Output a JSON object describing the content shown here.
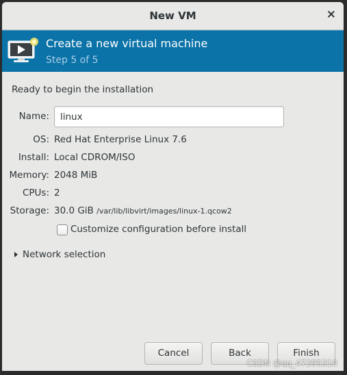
{
  "window": {
    "title": "New VM",
    "close_glyph": "×"
  },
  "banner": {
    "title": "Create a new virtual machine",
    "step": "Step 5 of 5",
    "icon": "virtual-machine-new-icon",
    "background_color": "#0b73a8"
  },
  "summary": {
    "heading": "Ready to begin the installation",
    "name": {
      "label": "Name:",
      "value": "linux"
    },
    "os": {
      "label": "OS:",
      "value": "Red Hat Enterprise Linux 7.6"
    },
    "install": {
      "label": "Install:",
      "value": "Local CDROM/ISO"
    },
    "memory": {
      "label": "Memory:",
      "value": "2048 MiB"
    },
    "cpus": {
      "label": "CPUs:",
      "value": "2"
    },
    "storage": {
      "label": "Storage:",
      "value": "30.0 GiB",
      "path": "/var/lib/libvirt/images/linux-1.qcow2"
    }
  },
  "customize": {
    "label": "Customize configuration before install",
    "checked": false
  },
  "network": {
    "label": "Network selection",
    "expanded": false
  },
  "buttons": {
    "cancel": "Cancel",
    "back": "Back",
    "finish": "Finish"
  },
  "watermark": "CSDN @qq_47295318"
}
